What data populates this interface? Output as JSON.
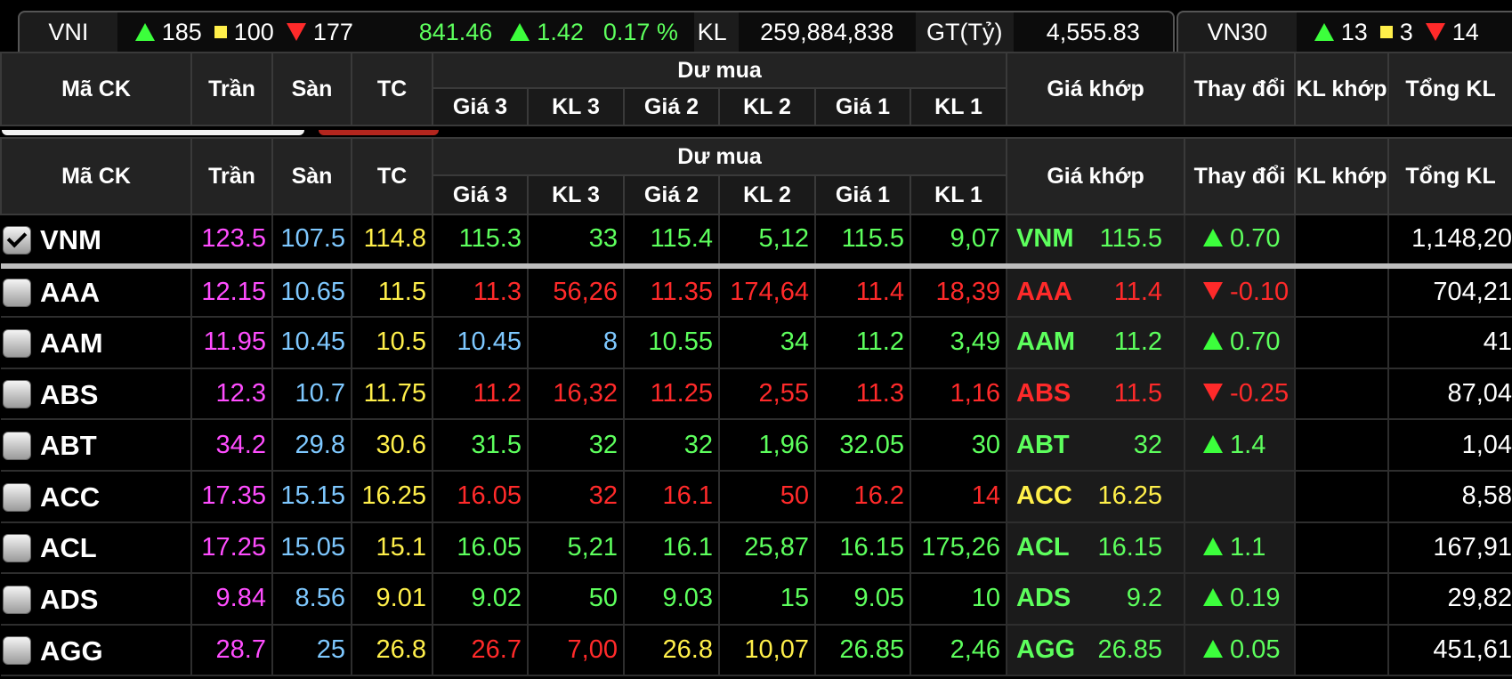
{
  "vni": {
    "name": "VNI",
    "up_count": "185",
    "ref_count": "100",
    "down_count": "177",
    "index": "841.46",
    "change": "1.42",
    "change_pct": "0.17 %",
    "kl_label": "KL",
    "kl_value": "259,884,838",
    "gt_label": "GT(Tỷ)",
    "gt_value": "4,555.83"
  },
  "vn30": {
    "name": "VN30",
    "up_count": "13",
    "ref_count": "3",
    "down_count": "14"
  },
  "headers": {
    "ma_ck": "Mã CK",
    "tran": "Trần",
    "san": "Sàn",
    "tc": "TC",
    "du_mua": "Dư mua",
    "gia3": "Giá 3",
    "kl3": "KL 3",
    "gia2": "Giá 2",
    "kl2": "KL 2",
    "gia1": "Giá 1",
    "kl1": "KL 1",
    "gia_khop": "Giá khớp",
    "thay_doi": "Thay đổi",
    "kl_khop": "KL khớp",
    "tong_kl": "Tổng KL"
  },
  "colors": {
    "ceiling": "#ff4dff",
    "floor": "#7ec8ff",
    "reference": "#ffef4a",
    "up": "#5dff5d",
    "down": "#ff2a2a"
  },
  "rows": [
    {
      "sym": "VNM",
      "checked": true,
      "tran": "123.5",
      "san": "107.5",
      "tc": "114.8",
      "g3": "115.3",
      "k3": "33",
      "g2": "115.4",
      "k2": "5,12",
      "g1": "115.5",
      "k1": "9,07",
      "khop": "115.5",
      "chg": "0.70",
      "dir": "up",
      "tot": "1,148,20",
      "c": {
        "g3": "g",
        "k3": "g",
        "g2": "g",
        "k2": "g",
        "g1": "g",
        "k1": "g",
        "khop": "g",
        "chg": "g"
      }
    },
    {
      "sym": "AAA",
      "checked": false,
      "tran": "12.15",
      "san": "10.65",
      "tc": "11.5",
      "g3": "11.3",
      "k3": "56,26",
      "g2": "11.35",
      "k2": "174,64",
      "g1": "11.4",
      "k1": "18,39",
      "khop": "11.4",
      "chg": "-0.10",
      "dir": "down",
      "tot": "704,21",
      "c": {
        "g3": "r",
        "k3": "r",
        "g2": "r",
        "k2": "r",
        "g1": "r",
        "k1": "r",
        "khop": "r",
        "chg": "r"
      }
    },
    {
      "sym": "AAM",
      "checked": false,
      "tran": "11.95",
      "san": "10.45",
      "tc": "10.5",
      "g3": "10.45",
      "k3": "8",
      "g2": "10.55",
      "k2": "34",
      "g1": "11.2",
      "k1": "3,49",
      "khop": "11.2",
      "chg": "0.70",
      "dir": "up",
      "tot": "41",
      "c": {
        "g3": "b",
        "k3": "b",
        "g2": "g",
        "k2": "g",
        "g1": "g",
        "k1": "g",
        "khop": "g",
        "chg": "g"
      }
    },
    {
      "sym": "ABS",
      "checked": false,
      "tran": "12.3",
      "san": "10.7",
      "tc": "11.75",
      "g3": "11.2",
      "k3": "16,32",
      "g2": "11.25",
      "k2": "2,55",
      "g1": "11.3",
      "k1": "1,16",
      "khop": "11.5",
      "chg": "-0.25",
      "dir": "down",
      "tot": "87,04",
      "c": {
        "g3": "r",
        "k3": "r",
        "g2": "r",
        "k2": "r",
        "g1": "r",
        "k1": "r",
        "khop": "r",
        "chg": "r"
      }
    },
    {
      "sym": "ABT",
      "checked": false,
      "tran": "34.2",
      "san": "29.8",
      "tc": "30.6",
      "g3": "31.5",
      "k3": "32",
      "g2": "32",
      "k2": "1,96",
      "g1": "32.05",
      "k1": "30",
      "khop": "32",
      "chg": "1.4",
      "dir": "up",
      "tot": "1,04",
      "c": {
        "g3": "g",
        "k3": "g",
        "g2": "g",
        "k2": "g",
        "g1": "g",
        "k1": "g",
        "khop": "g",
        "chg": "g"
      }
    },
    {
      "sym": "ACC",
      "checked": false,
      "tran": "17.35",
      "san": "15.15",
      "tc": "16.25",
      "g3": "16.05",
      "k3": "32",
      "g2": "16.1",
      "k2": "50",
      "g1": "16.2",
      "k1": "14",
      "khop": "16.25",
      "chg": "",
      "dir": "none",
      "tot": "8,58",
      "c": {
        "g3": "r",
        "k3": "r",
        "g2": "r",
        "k2": "r",
        "g1": "r",
        "k1": "r",
        "khop": "y",
        "chg": "y"
      }
    },
    {
      "sym": "ACL",
      "checked": false,
      "tran": "17.25",
      "san": "15.05",
      "tc": "15.1",
      "g3": "16.05",
      "k3": "5,21",
      "g2": "16.1",
      "k2": "25,87",
      "g1": "16.15",
      "k1": "175,26",
      "khop": "16.15",
      "chg": "1.1",
      "dir": "up",
      "tot": "167,91",
      "c": {
        "g3": "g",
        "k3": "g",
        "g2": "g",
        "k2": "g",
        "g1": "g",
        "k1": "g",
        "khop": "g",
        "chg": "g"
      }
    },
    {
      "sym": "ADS",
      "checked": false,
      "tran": "9.84",
      "san": "8.56",
      "tc": "9.01",
      "g3": "9.02",
      "k3": "50",
      "g2": "9.03",
      "k2": "15",
      "g1": "9.05",
      "k1": "10",
      "khop": "9.2",
      "chg": "0.19",
      "dir": "up",
      "tot": "29,82",
      "c": {
        "g3": "g",
        "k3": "g",
        "g2": "g",
        "k2": "g",
        "g1": "g",
        "k1": "g",
        "khop": "g",
        "chg": "g"
      }
    },
    {
      "sym": "AGG",
      "checked": false,
      "tran": "28.7",
      "san": "25",
      "tc": "26.8",
      "g3": "26.7",
      "k3": "7,00",
      "g2": "26.8",
      "k2": "10,07",
      "g1": "26.85",
      "k1": "2,46",
      "khop": "26.85",
      "chg": "0.05",
      "dir": "up",
      "tot": "451,61",
      "c": {
        "g3": "r",
        "k3": "r",
        "g2": "y",
        "k2": "y",
        "g1": "g",
        "k1": "g",
        "khop": "g",
        "chg": "g"
      }
    }
  ]
}
